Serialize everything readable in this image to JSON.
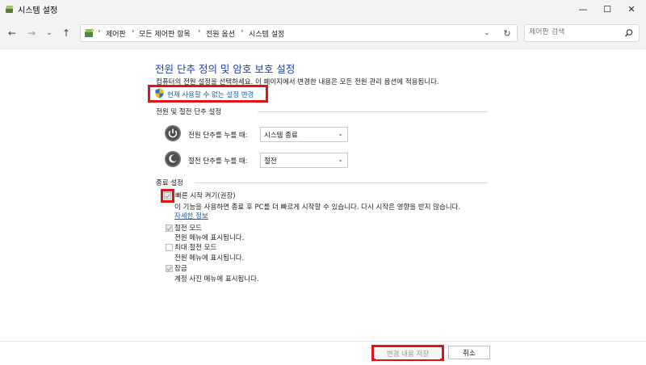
{
  "window": {
    "title": "시스템 설정",
    "minimize": "—",
    "maximize": "☐",
    "close": "✕"
  },
  "nav": {
    "breadcrumbs": [
      "제어판",
      "모든 제어판 항목",
      "전원 옵션",
      "시스템 설정"
    ],
    "search_placeholder": "제어판 검색"
  },
  "main": {
    "title": "전원 단추 정의 및 암호 보호 설정",
    "description": "컴퓨터의 전원 설정을 선택하세요. 이 페이지에서 변경한 내용은 모든 전원 관리 옵션에 적용됩니다.",
    "change_link": "현재 사용할 수 없는 설정 변경"
  },
  "power_section": {
    "heading": "전원 및 절전 단추 설정",
    "rows": [
      {
        "label": "전원 단추를 누를 때:",
        "value": "시스템 종료"
      },
      {
        "label": "절전 단추를 누를 때:",
        "value": "절전"
      }
    ]
  },
  "shutdown_section": {
    "heading": "종료 설정",
    "options": [
      {
        "label": "빠른 시작 켜기(권장)",
        "checked": true,
        "description": "이 기능을 사용하면 종료 후 PC를 더 빠르게 시작할 수 있습니다. 다시 시작은 영향을 받지 않습니다.",
        "link": "자세한 정보"
      },
      {
        "label": "절전 모드",
        "checked": true,
        "description": "전원 메뉴에 표시됩니다."
      },
      {
        "label": "최대 절전 모드",
        "checked": false,
        "description": "전원 메뉴에 표시됩니다."
      },
      {
        "label": "잠금",
        "checked": true,
        "description": "계정 사진 메뉴에 표시됩니다."
      }
    ]
  },
  "footer": {
    "save": "변경 내용 저장",
    "cancel": "취소"
  },
  "colors": {
    "highlight": "#e01414",
    "link": "#1a5fb4",
    "title": "#1e3ea8"
  }
}
